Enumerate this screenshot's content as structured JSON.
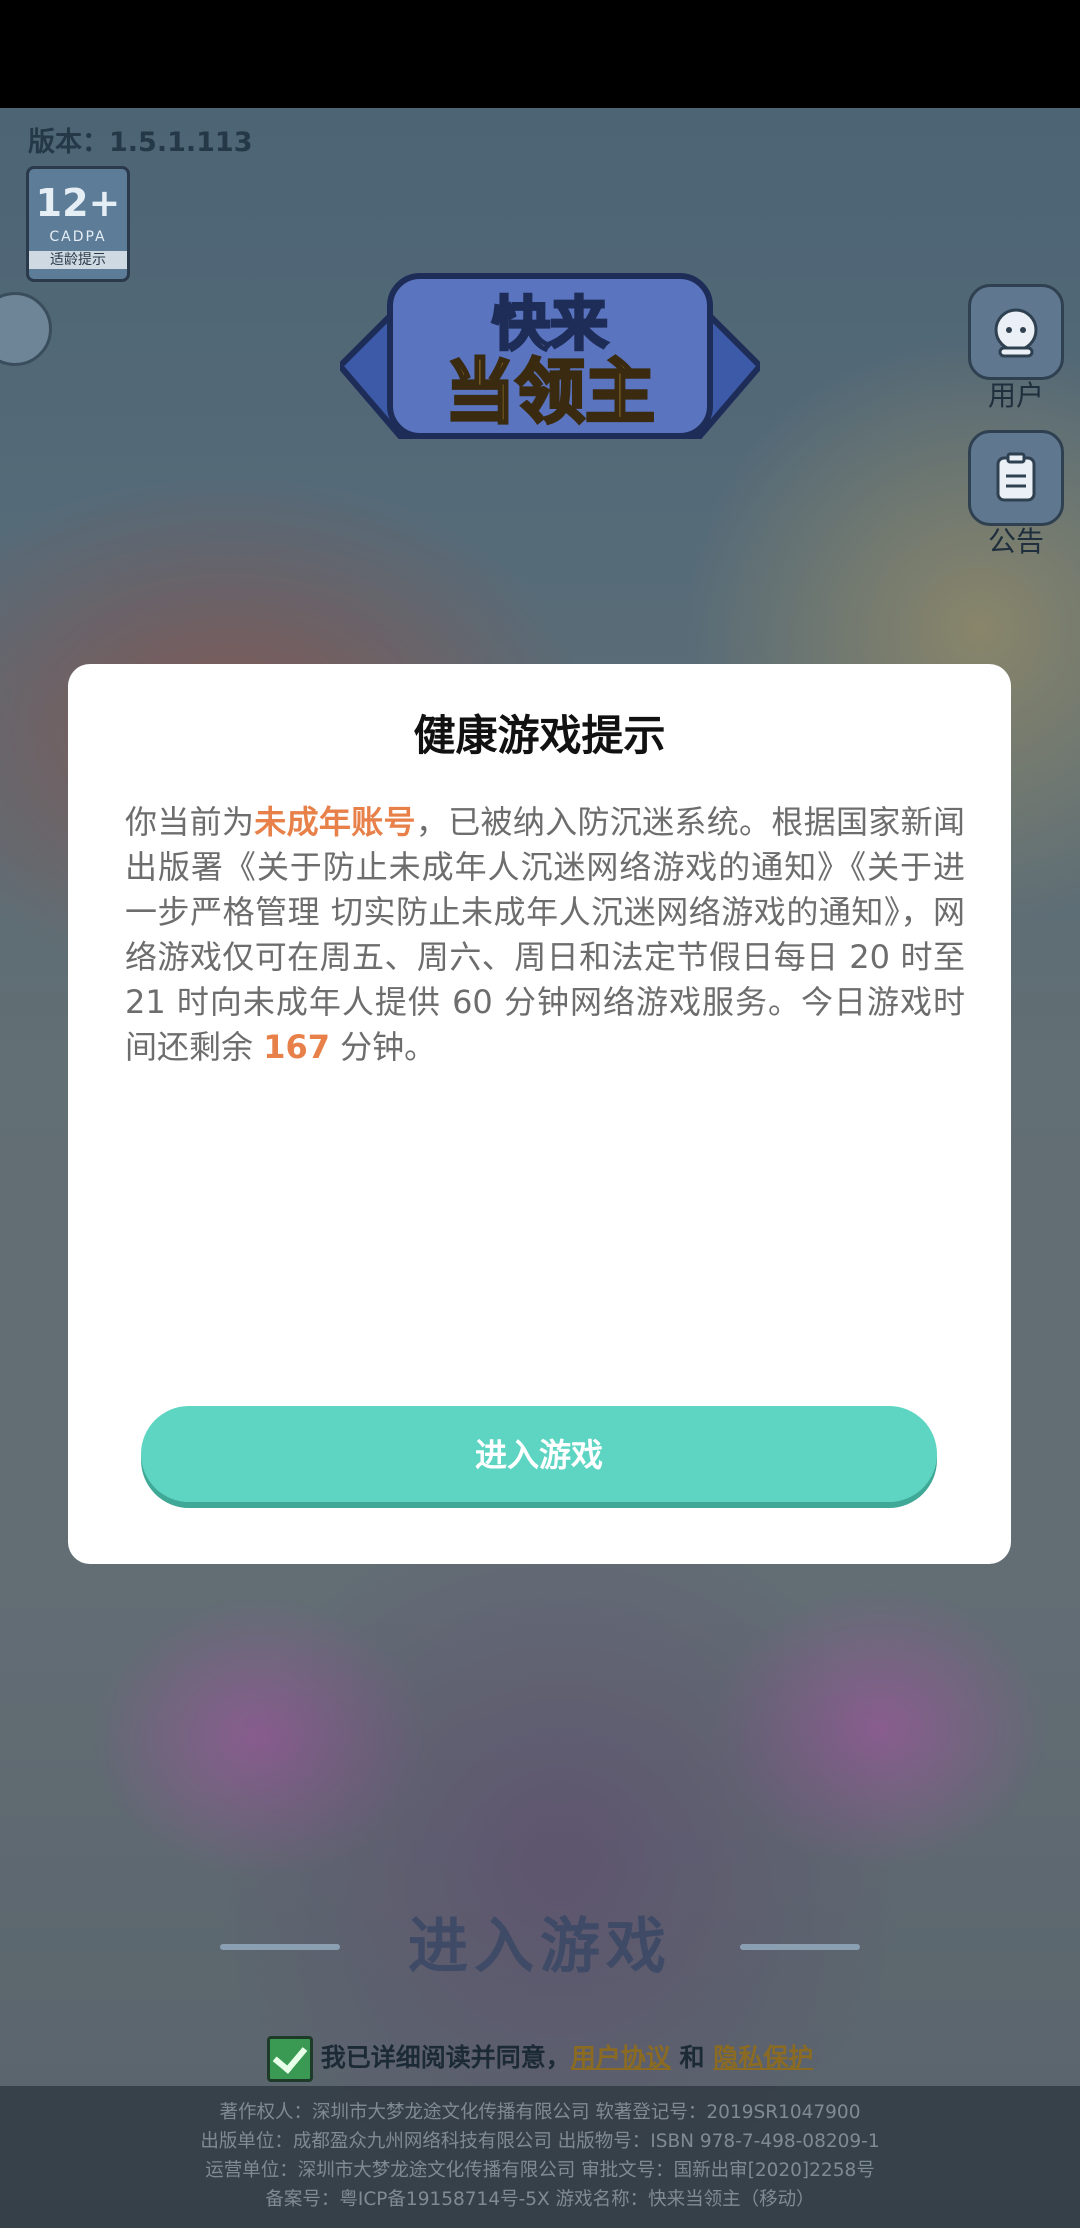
{
  "status_bar": {},
  "game": {
    "version_text": "版本：1.5.1.113",
    "age_badge": {
      "age": "12+",
      "org": "CADPA",
      "tip": "适龄提示"
    },
    "logo_text": "快来当领主",
    "side_buttons": [
      {
        "label": "用户",
        "icon": "user-icon"
      },
      {
        "label": "公告",
        "icon": "notice-icon"
      }
    ],
    "bottom_enter_text": "进入游戏",
    "agreement": {
      "prefix": "我已详细阅读并同意，",
      "user_agreement": "用户协议",
      "and": "和",
      "privacy": "隐私保护"
    },
    "footer_lines": [
      "著作权人：深圳市大梦龙途文化传播有限公司  软著登记号：2019SR1047900",
      "出版单位：成都盈众九州网络科技有限公司  出版物号：ISBN 978-7-498-08209-1",
      "运营单位：深圳市大梦龙途文化传播有限公司  审批文号：国新出审[2020]2258号",
      "备案号：粤ICP备19158714号-5X  游戏名称：快来当领主（移动）"
    ]
  },
  "dialog": {
    "title": "健康游戏提示",
    "body_before": "你当前为",
    "highlight_account": "未成年账号",
    "body_middle": "，已被纳入防沉迷系统。根据国家新闻出版署《关于防止未成年人沉迷网络游戏的通知》《关于进一步严格管理 切实防止未成年人沉迷网络游戏的通知》，网络游戏仅可在周五、周六、周日和法定节假日每日 20 时至 21 时向未成年人提供 60 分钟网络游戏服务。今日游戏时间还剩余 ",
    "remaining_minutes": "167",
    "body_after": " 分钟。",
    "button_label": "进入游戏",
    "accent_color": "#5ed5c2",
    "highlight_color": "#e8804a"
  }
}
